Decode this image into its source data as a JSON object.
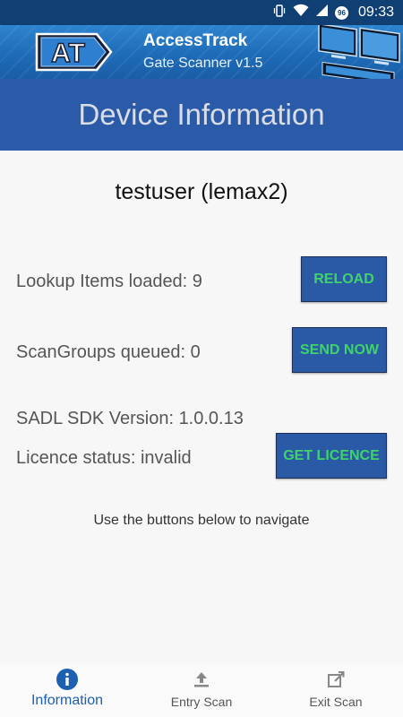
{
  "status_bar": {
    "time": "09:33",
    "battery_level": "96",
    "icons": [
      "vibrate-icon",
      "wifi-icon",
      "signal-icon",
      "battery-icon"
    ]
  },
  "app": {
    "logo_text": "AT",
    "title": "AccessTrack",
    "subtitle": "Gate Scanner v1.5"
  },
  "page": {
    "title": "Device Information"
  },
  "user": {
    "display": "testuser (lemax2)"
  },
  "info": {
    "lookup_items": "Lookup Items loaded: 9",
    "scan_groups": "ScanGroups queued: 0",
    "sdk_version": "SADL SDK Version: 1.0.0.13",
    "licence_status": "Licence status: invalid"
  },
  "buttons": {
    "reload": "RELOAD",
    "send_now": "SEND NOW",
    "get_licence": "GET LICENCE"
  },
  "hint": "Use the buttons below to navigate",
  "bottom_nav": {
    "items": [
      {
        "label": "Information",
        "icon": "info-icon",
        "active": true
      },
      {
        "label": "Entry Scan",
        "icon": "upload-icon",
        "active": false
      },
      {
        "label": "Exit Scan",
        "icon": "exit-edit-icon",
        "active": false
      }
    ]
  },
  "colors": {
    "status_bar": "#0f3f73",
    "header": "#2b5aa8",
    "button_bg": "#2a5aa6",
    "button_text": "#3fd36b",
    "active_nav": "#1d5fb0"
  }
}
